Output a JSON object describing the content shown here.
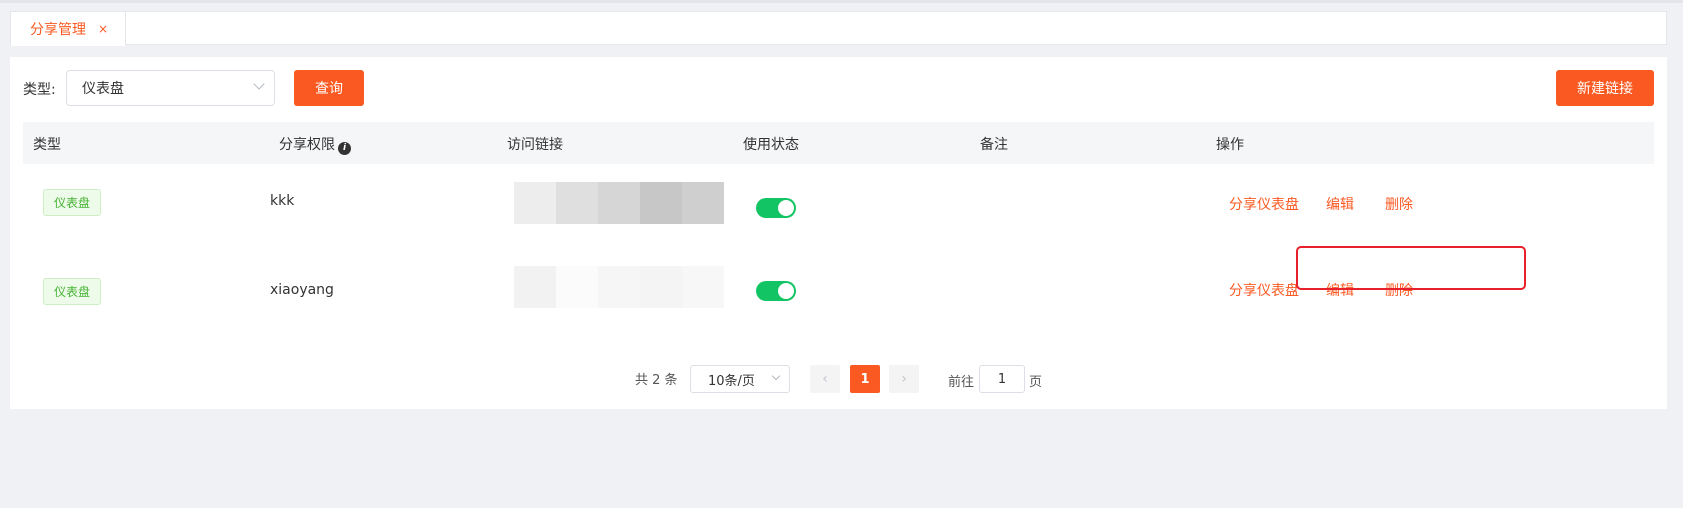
{
  "tabs": [
    {
      "label": "分享管理",
      "close": "×"
    }
  ],
  "filter": {
    "label": "类型:",
    "selected": "仪表盘",
    "query_button": "查询",
    "new_button": "新建链接"
  },
  "table": {
    "headers": {
      "type": "类型",
      "permission": "分享权限",
      "link": "访问链接",
      "status": "使用状态",
      "remark": "备注",
      "actions": "操作"
    },
    "info_icon": "i",
    "rows": [
      {
        "type": "仪表盘",
        "permission": "kkk",
        "enabled": true,
        "remark": "",
        "actions": {
          "share": "分享仪表盘",
          "edit": "编辑",
          "delete": "删除"
        }
      },
      {
        "type": "仪表盘",
        "permission": "xiaoyang",
        "enabled": true,
        "remark": "",
        "actions": {
          "share": "分享仪表盘",
          "edit": "编辑",
          "delete": "删除"
        }
      }
    ]
  },
  "pagination": {
    "total": "共 2 条",
    "page_size": "10条/页",
    "prev": "‹",
    "current": "1",
    "next": "›",
    "jump_prefix": "前往",
    "jump_value": "1",
    "jump_suffix": "页"
  },
  "colors": {
    "accent": "#fa5a22",
    "toggle_on": "#13c464",
    "tag_green": "#44b233",
    "highlight": "#e8202a"
  }
}
